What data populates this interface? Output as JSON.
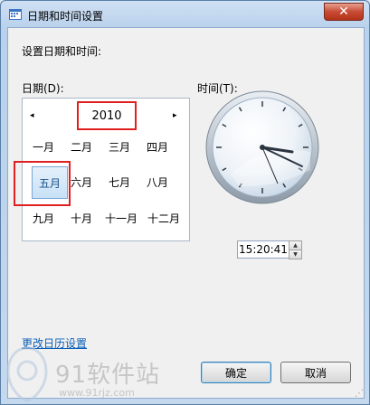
{
  "window": {
    "title": "日期和时间设置"
  },
  "heading": "设置日期和时间:",
  "date_label": "日期(D):",
  "time_label": "时间(T):",
  "calendar": {
    "year": "2010",
    "prev_arrow": "◂",
    "next_arrow": "▸",
    "months": [
      "一月",
      "二月",
      "三月",
      "四月",
      "五月",
      "六月",
      "七月",
      "八月",
      "九月",
      "十月",
      "十一月",
      "十二月"
    ],
    "selected_month": "五月"
  },
  "time": {
    "value": "15:20:41"
  },
  "link": "更改日历设置",
  "buttons": {
    "ok": "确定",
    "cancel": "取消"
  },
  "watermark": {
    "brand": "91软件站",
    "url": "www.91rjz.com"
  },
  "colors": {
    "accent": "#0a5fb7",
    "highlight": "#e02020"
  }
}
